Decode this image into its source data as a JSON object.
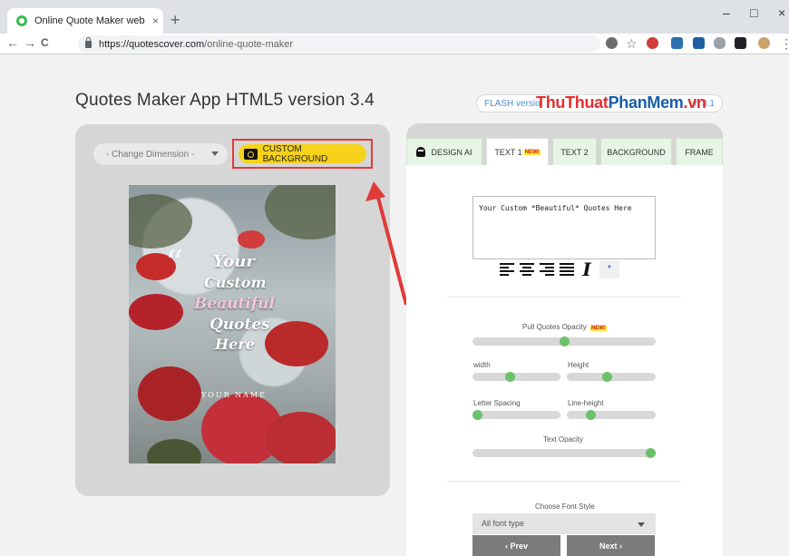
{
  "browser": {
    "tab_title": "Online Quote Maker web applica",
    "tab_close": "×",
    "new_tab": "+",
    "url_host": "https://quotescover.com",
    "url_path": "/online-quote-maker",
    "back": "←",
    "forward": "→",
    "reload": "C",
    "star": "☆",
    "minimize": "–",
    "maximize": "□",
    "close": "×",
    "menu": "⋮"
  },
  "page": {
    "title": "Quotes Maker App HTML5 version 3.4",
    "flash_label": "FLASH versio",
    "flash_version": "n 3.1",
    "watermark_red": "ThuThuat",
    "watermark_blue": "PhanMem",
    "watermark_tail": ".vn"
  },
  "left_panel": {
    "dimension_select": "- Change Dimension -",
    "custom_background_label": "CUSTOM BACKGROUND",
    "quote_lines": [
      "Your",
      "Custom",
      "Beautiful",
      "Quotes",
      "Here"
    ],
    "quote_mark": "“",
    "author": "YOUR NAME"
  },
  "right_panel": {
    "tabs": [
      {
        "label": "DESIGN AI"
      },
      {
        "label": "TEXT 1",
        "badge": "NEW!"
      },
      {
        "label": "TEXT 2"
      },
      {
        "label": "BACKGROUND"
      },
      {
        "label": "FRAME"
      }
    ],
    "quote_text": "Your Custom *Beautiful* Quotes Here",
    "italic_glyph": "I",
    "star_glyph": "*",
    "sliders": {
      "pull_quotes_opacity": {
        "label": "Pull Quotes Opacity",
        "badge": "NEW!",
        "value": 0.5
      },
      "width": {
        "label": "width",
        "value": 0.43
      },
      "height": {
        "label": "Height",
        "value": 0.45
      },
      "letter_spacing": {
        "label": "Letter Spacing",
        "value": 0.05
      },
      "line_height": {
        "label": "Line-height",
        "value": 0.27
      },
      "text_opacity": {
        "label": "Text Opacity",
        "value": 0.98
      }
    },
    "font_style_label": "Choose Font Style",
    "font_select": "All font type",
    "prev_label": "‹ Prev",
    "next_label": "Next ›"
  },
  "colors": {
    "accent_yellow": "#f7d21a",
    "slider_knob": "#6cc06a",
    "highlight_red": "#e03a3a",
    "tab_green": "#e6f5e6"
  }
}
